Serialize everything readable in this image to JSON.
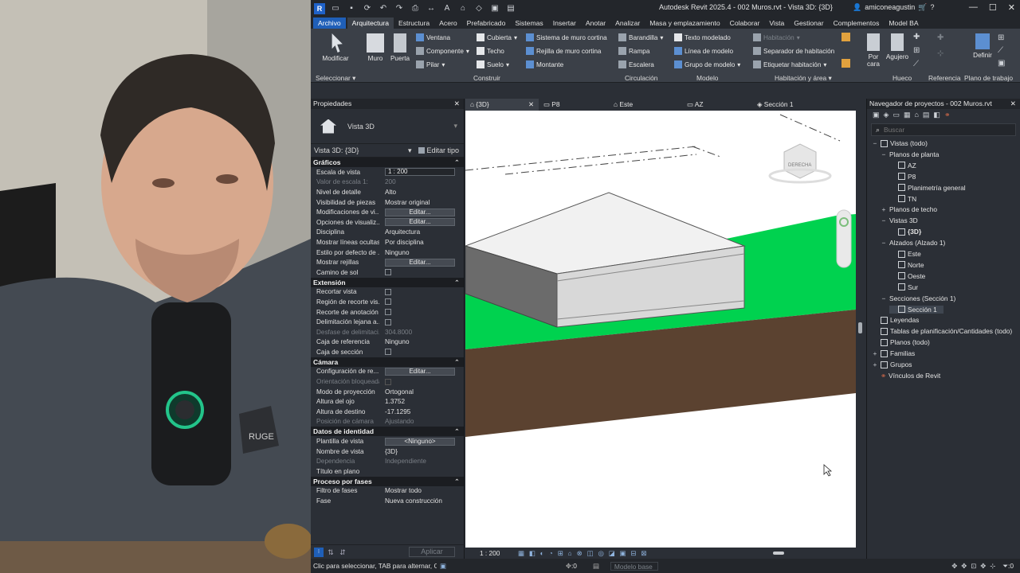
{
  "app": {
    "logo": "R",
    "title": "Autodesk Revit 2025.4 - 002 Muros.rvt - Vista 3D: {3D}",
    "user": "amiconeagustin",
    "window_buttons": [
      "—",
      "☐",
      "✕"
    ]
  },
  "menu": {
    "tabs": [
      "Archivo",
      "Arquitectura",
      "Estructura",
      "Acero",
      "Prefabricado",
      "Sistemas",
      "Insertar",
      "Anotar",
      "Analizar",
      "Masa y emplazamiento",
      "Colaborar",
      "Vista",
      "Gestionar",
      "Complementos",
      "Model BA"
    ]
  },
  "ribbon": {
    "modify": "Modificar",
    "select_group": "Seleccionar",
    "wall": "Muro",
    "door": "Puerta",
    "window": "Ventana",
    "component": "Componente",
    "column": "Pilar",
    "roof": "Cubierta",
    "ceiling": "Techo",
    "floor": "Suelo",
    "curtain_system": "Sistema de muro cortina",
    "curtain_grid": "Rejilla de muro cortina",
    "mullion": "Montante",
    "build_group": "Construir",
    "railing": "Barandilla",
    "ramp": "Rampa",
    "stair": "Escalera",
    "circulation_group": "Circulación",
    "model_text": "Texto modelado",
    "model_line": "Línea de modelo",
    "model_group": "Grupo de modelo",
    "model_group_label": "Modelo",
    "room": "Habitación",
    "room_separator": "Separador de habitación",
    "tag_room": "Etiquetar habitación",
    "room_area_group": "Habitación y área",
    "by_face": "Por cara",
    "shaft": "Agujero",
    "opening_group": "Hueco",
    "reference_group": "Referencia",
    "set": "Definir",
    "workplane_group": "Plano de trabajo"
  },
  "properties": {
    "title": "Propiedades",
    "type_name": "Vista 3D",
    "selector": "Vista 3D: {3D}",
    "edit_type": "Editar tipo",
    "apply": "Aplicar",
    "sections": [
      {
        "name": "Gráficos",
        "rows": [
          {
            "k": "Escala de vista",
            "v": "1 : 200",
            "kind": "field"
          },
          {
            "k": "Valor de escala    1:",
            "v": "200",
            "kind": "dis"
          },
          {
            "k": "Nivel de detalle",
            "v": "Alto"
          },
          {
            "k": "Visibilidad de piezas",
            "v": "Mostrar original"
          },
          {
            "k": "Modificaciones de vi...",
            "v": "Editar...",
            "kind": "btn"
          },
          {
            "k": "Opciones de visualiz...",
            "v": "Editar...",
            "kind": "btn"
          },
          {
            "k": "Disciplina",
            "v": "Arquitectura"
          },
          {
            "k": "Mostrar líneas ocultas",
            "v": "Por disciplina"
          },
          {
            "k": "Estilo por defecto de ...",
            "v": "Ninguno"
          },
          {
            "k": "Mostrar rejillas",
            "v": "Editar...",
            "kind": "btn"
          },
          {
            "k": "Camino de sol",
            "v": "",
            "kind": "cb"
          }
        ]
      },
      {
        "name": "Extensión",
        "rows": [
          {
            "k": "Recortar vista",
            "v": "",
            "kind": "cb"
          },
          {
            "k": "Región de recorte vis...",
            "v": "",
            "kind": "cb"
          },
          {
            "k": "Recorte de anotación",
            "v": "",
            "kind": "cb"
          },
          {
            "k": "Delimitación lejana a...",
            "v": "",
            "kind": "cb"
          },
          {
            "k": "Desfase de delimitaci...",
            "v": "304.8000",
            "kind": "dis"
          },
          {
            "k": "Caja de referencia",
            "v": "Ninguno"
          },
          {
            "k": "Caja de sección",
            "v": "",
            "kind": "cb"
          }
        ]
      },
      {
        "name": "Cámara",
        "rows": [
          {
            "k": "Configuración de re...",
            "v": "Editar...",
            "kind": "btn"
          },
          {
            "k": "Orientación bloqueada",
            "v": "",
            "kind": "cbdis"
          },
          {
            "k": "Modo de proyección",
            "v": "Ortogonal"
          },
          {
            "k": "Altura del ojo",
            "v": "1.3752"
          },
          {
            "k": "Altura de destino",
            "v": "-17.1295"
          },
          {
            "k": "Posición de cámara",
            "v": "Ajustando",
            "kind": "dis"
          }
        ]
      },
      {
        "name": "Datos de identidad",
        "rows": [
          {
            "k": "Plantilla de vista",
            "v": "<Ninguno>",
            "kind": "btn"
          },
          {
            "k": "Nombre de vista",
            "v": "{3D}"
          },
          {
            "k": "Dependencia",
            "v": "Independiente",
            "kind": "dis"
          },
          {
            "k": "Título en plano",
            "v": ""
          }
        ]
      },
      {
        "name": "Proceso por fases",
        "rows": [
          {
            "k": "Filtro de fases",
            "v": "Mostrar todo"
          },
          {
            "k": "Fase",
            "v": "Nueva construcción"
          }
        ]
      }
    ]
  },
  "view_tabs": [
    "{3D}",
    "P8",
    "Este",
    "AZ",
    "Sección 1"
  ],
  "viewcube_label": "DERECHA",
  "view_bar": {
    "scale": "1 : 200"
  },
  "browser": {
    "title": "Navegador de proyectos - 002 Muros.rvt",
    "search_placeholder": "Buscar",
    "items": [
      {
        "label": "Vistas (todo)",
        "lvl": 0,
        "pm": "−"
      },
      {
        "label": "Planos de planta",
        "lvl": 1,
        "pm": "−"
      },
      {
        "label": "AZ",
        "lvl": 2
      },
      {
        "label": "P8",
        "lvl": 2
      },
      {
        "label": "Planimetría general",
        "lvl": 2
      },
      {
        "label": "TN",
        "lvl": 2
      },
      {
        "label": "Planos de techo",
        "lvl": 1,
        "pm": "+"
      },
      {
        "label": "Vistas 3D",
        "lvl": 1,
        "pm": "−"
      },
      {
        "label": "{3D}",
        "lvl": 2,
        "bold": true
      },
      {
        "label": "Alzados (Alzado 1)",
        "lvl": 1,
        "pm": "−"
      },
      {
        "label": "Este",
        "lvl": 2
      },
      {
        "label": "Norte",
        "lvl": 2
      },
      {
        "label": "Oeste",
        "lvl": 2
      },
      {
        "label": "Sur",
        "lvl": 2
      },
      {
        "label": "Secciones (Sección 1)",
        "lvl": 1,
        "pm": "−"
      },
      {
        "label": "Sección 1",
        "lvl": 2,
        "selected": true
      },
      {
        "label": "Leyendas",
        "lvl": 0
      },
      {
        "label": "Tablas de planificación/Cantidades (todo)",
        "lvl": 0
      },
      {
        "label": "Planos (todo)",
        "lvl": 0
      },
      {
        "label": "Familias",
        "lvl": 0,
        "pm": "+"
      },
      {
        "label": "Grupos",
        "lvl": 0,
        "pm": "+"
      },
      {
        "label": "Vínculos de Revit",
        "lvl": 0
      }
    ]
  },
  "status": {
    "message": "Clic para seleccionar, TAB para alternar, C",
    "zero1": ":0",
    "model": "Modelo base",
    "filter_count": ":0"
  },
  "webcam_brand": "RUGE",
  "colors": {
    "green": "#00d24f",
    "brown": "#5b4230",
    "accent": "#1f5fb8"
  }
}
